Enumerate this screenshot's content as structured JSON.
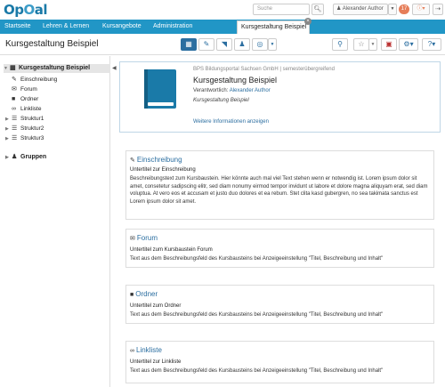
{
  "header": {
    "logo": "OpOal",
    "search_placeholder": "Suche",
    "user_name": "Alexander Author",
    "notifications": "17"
  },
  "nav": {
    "items": [
      "Startseite",
      "Lehren & Lernen",
      "Kursangebote",
      "Administration"
    ],
    "active_tab": "Kursgestaltung Beispiel"
  },
  "toolbar": {
    "title": "Kursgestaltung Beispiel"
  },
  "sidebar": {
    "root": "Kursgestaltung Beispiel",
    "items": [
      {
        "label": "Einschreibung",
        "icon": "pencil-icon"
      },
      {
        "label": "Forum",
        "icon": "forum-icon"
      },
      {
        "label": "Ordner",
        "icon": "folder-icon"
      },
      {
        "label": "Linkliste",
        "icon": "link-icon"
      },
      {
        "label": "Struktur1",
        "icon": "structure-icon"
      },
      {
        "label": "Struktur2",
        "icon": "structure-icon"
      },
      {
        "label": "Struktur3",
        "icon": "structure-icon"
      },
      {
        "label": "Gruppen",
        "icon": "group-icon"
      }
    ]
  },
  "course": {
    "org": "BPS Bildungsportal Sachsen GmbH | semesterübergreifend",
    "title": "Kursgestaltung Beispiel",
    "responsible_label": "Verantwortlich:",
    "responsible_name": "Alexander Author",
    "subtitle": "Kursgestaltung Beispiel",
    "more_info": "Weitere Informationen anzeigen"
  },
  "cards": [
    {
      "title": "Einschreibung",
      "subtitle": "Untertitel zur Einschreibung",
      "body": "Beschreibungstext zum Kursbaustein. Hier könnte auch mal viel Text stehen wenn er notwendig ist. Lorem ipsum dolor sit amet, consetetur sadipscing elitr, sed diam nonumy eirmod tempor invidunt ut labore et dolore magna aliquyam erat, sed diam voluptua. At vero eos et accusam et justo duo dolores et ea rebum. Stet clita kasd gubergren, no sea takimata sanctus est Lorem ipsum dolor sit amet."
    },
    {
      "title": "Forum",
      "subtitle": "Untertitel zum Kursbaustein Forum",
      "body": "Text aus dem Beschreibungsfeld des Kursbausteins bei Anzeigeeinstellung  \"Titel, Beschreibung und Inhalt\""
    },
    {
      "title": "Ordner",
      "subtitle": "Untertitel zum Ordner",
      "body": "Text aus dem Beschreibungsfeld des Kursbausteins bei Anzeigeeinstellung  \"Titel, Beschreibung und Inhalt\""
    },
    {
      "title": "Linkliste",
      "subtitle": "Untertitel zur Linkliste",
      "body": "Text aus dem Beschreibungsfeld des Kursbausteins bei Anzeigeeinstellung  \"Titel, Beschreibung und Inhalt\""
    }
  ]
}
